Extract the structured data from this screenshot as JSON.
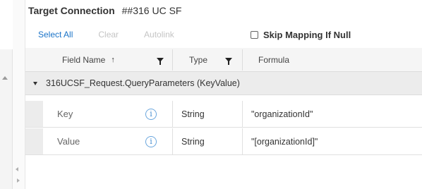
{
  "header": {
    "title_label": "Target Connection",
    "title_value": "##316 UC SF"
  },
  "toolbar": {
    "select_all": "Select All",
    "clear": "Clear",
    "autolink": "Autolink",
    "skip_mapping": "Skip Mapping If Null"
  },
  "columns": {
    "field_name": "Field Name",
    "type": "Type",
    "formula": "Formula"
  },
  "group": {
    "label": "316UCSF_Request.QueryParameters (KeyValue)"
  },
  "rows": [
    {
      "name": "Key",
      "type": "String",
      "formula": "\"organizationId\""
    },
    {
      "name": "Value",
      "type": "String",
      "formula": "\"[organizationId]\""
    }
  ],
  "colors": {
    "link": "#1a73c8",
    "disabled": "#c4c4c4",
    "info_icon": "#4a8fd0"
  },
  "icons": [
    "filter-icon",
    "sort-ascending-icon",
    "expand-caret-icon",
    "info-icon",
    "checkbox-icon"
  ]
}
